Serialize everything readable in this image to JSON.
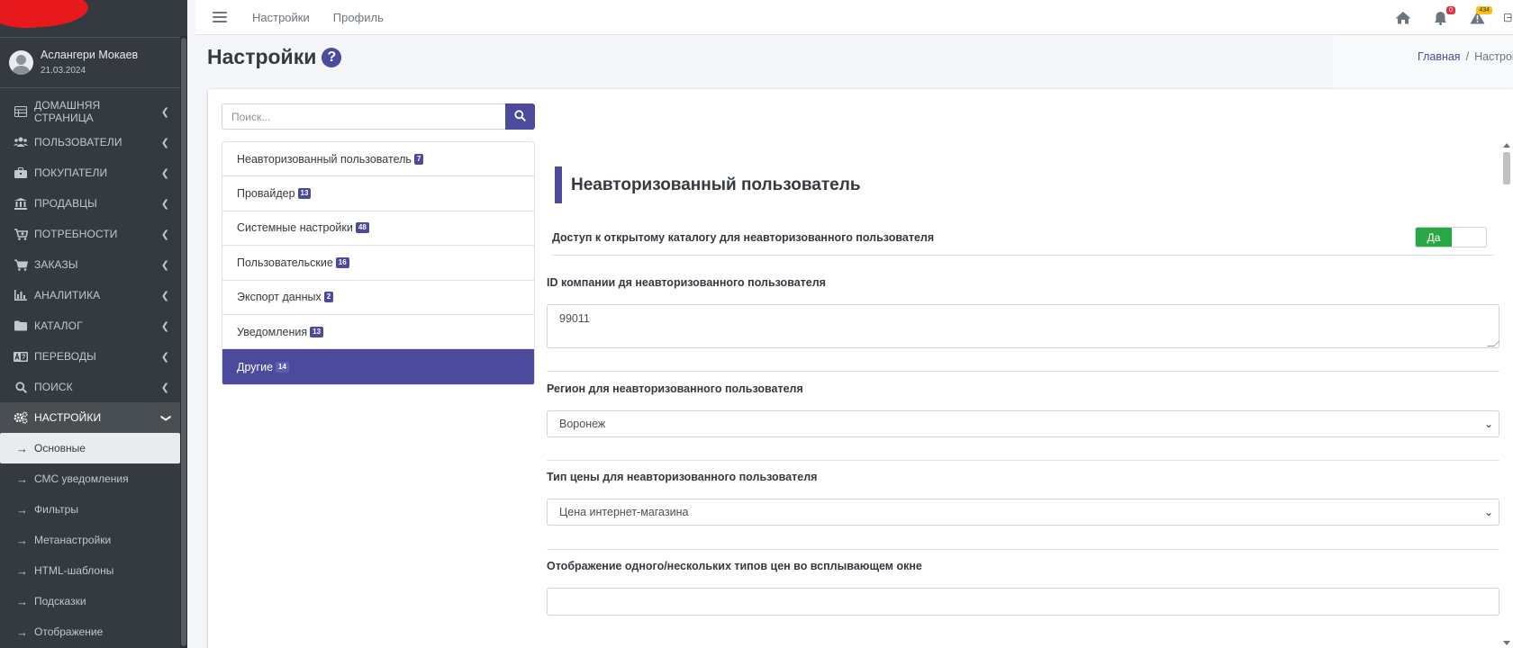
{
  "sidebar": {
    "user": {
      "name": "Аслангери Мокаев",
      "date": "21.03.2024"
    },
    "items": [
      {
        "label": "ДОМАШНЯЯ СТРАНИЦА",
        "icon": "table-icon"
      },
      {
        "label": "ПОЛЬЗОВАТЕЛИ",
        "icon": "users-icon"
      },
      {
        "label": "ПОКУПАТЕЛИ",
        "icon": "briefcase-icon"
      },
      {
        "label": "ПРОДАВЦЫ",
        "icon": "bank-icon"
      },
      {
        "label": "ПОТРЕБНОСТИ",
        "icon": "cart-plus-icon"
      },
      {
        "label": "ЗАКАЗЫ",
        "icon": "cart-icon"
      },
      {
        "label": "АНАЛИТИКА",
        "icon": "chart-icon"
      },
      {
        "label": "КАТАЛОГ",
        "icon": "folder-icon"
      },
      {
        "label": "ПЕРЕВОДЫ",
        "icon": "language-icon"
      },
      {
        "label": "ПОИСК",
        "icon": "search-icon"
      },
      {
        "label": "НАСТРОЙКИ",
        "icon": "cogs-icon"
      }
    ],
    "sub_items": [
      {
        "label": "Основные"
      },
      {
        "label": "СМС уведомления"
      },
      {
        "label": "Фильтры"
      },
      {
        "label": "Метанастройки"
      },
      {
        "label": "HTML-шаблоны"
      },
      {
        "label": "Подсказки"
      },
      {
        "label": "Отображение"
      }
    ]
  },
  "topbar": {
    "links": [
      "Настройки",
      "Профиль"
    ],
    "notifications_badge": "0",
    "warnings_badge": "434"
  },
  "header": {
    "title": "Настройки",
    "breadcrumb_home": "Главная",
    "breadcrumb_current": "Настрой"
  },
  "search": {
    "placeholder": "Поиск..."
  },
  "categories": [
    {
      "label": "Неавторизованный пользователь",
      "count": "7"
    },
    {
      "label": "Провайдер",
      "count": "13"
    },
    {
      "label": "Системные настройки",
      "count": "48"
    },
    {
      "label": "Пользовательские",
      "count": "16"
    },
    {
      "label": "Экспорт данных",
      "count": "2"
    },
    {
      "label": "Уведомления",
      "count": "13"
    },
    {
      "label": "Другие",
      "count": "14"
    }
  ],
  "pane": {
    "section_title": "Неавторизованный пользователь",
    "toggle_label": "Доступ к открытому каталогу для неавторизованного пользователя",
    "toggle_value": "Да",
    "company_label": "ID компании дя неавторизованного пользователя",
    "company_value": "99011",
    "region_label": "Регион для неавторизованного пользователя",
    "region_value": "Воронеж",
    "price_type_label": "Тип цены для неавторизованного пользователя",
    "price_type_value": "Цена интернет-магазина",
    "display_label": "Отображение одного/нескольких типов цен во всплывающем окне",
    "display_value": ""
  },
  "colors": {
    "sidebar_bg": "#343a40",
    "accent": "#4b4a9c",
    "toggle_on": "#28a745",
    "badge_red": "#dc3545",
    "badge_yellow": "#ffc107"
  }
}
